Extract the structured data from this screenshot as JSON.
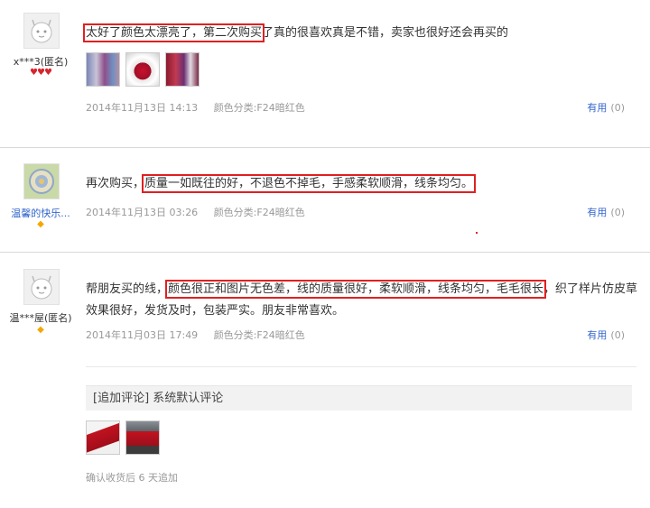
{
  "reviews": [
    {
      "user": "x***3(匿名)",
      "text_before": "",
      "text_highlight": "太好了颜色太漂亮了，第二次购买",
      "text_after": "了真的很喜欢真是不错，卖家也很好还会再买的",
      "date": "2014年11月13日 14:13",
      "variant": "颜色分类:F24暗红色",
      "useful_label": "有用",
      "useful_count": "(0)"
    },
    {
      "user": "温馨的快乐...",
      "text_before": "再次购买，",
      "text_highlight": "质量一如既往的好，不退色不掉毛，手感柔软顺滑，线条均匀。",
      "text_after": "",
      "date": "2014年11月13日 03:26",
      "variant": "颜色分类:F24暗红色",
      "useful_label": "有用",
      "useful_count": "(0)"
    },
    {
      "user": "温***屋(匿名)",
      "text_before": "帮朋友买的线，",
      "text_highlight": "颜色很正和图片无色差，线的质量很好，柔软顺滑，线条均匀，毛毛很长",
      "text_after": "，织了样片仿皮草效果很好，发货及时，包装严实。朋友非常喜欢。",
      "date": "2014年11月03日 17:49",
      "variant": "颜色分类:F24暗红色",
      "useful_label": "有用",
      "useful_count": "(0)",
      "append_title": "[追加评论] 系统默认评论",
      "append_note": "确认收货后 6 天追加"
    }
  ],
  "colors": {
    "highlight_border": "#e02020",
    "link_blue": "#3366cc",
    "meta_gray": "#999999"
  }
}
